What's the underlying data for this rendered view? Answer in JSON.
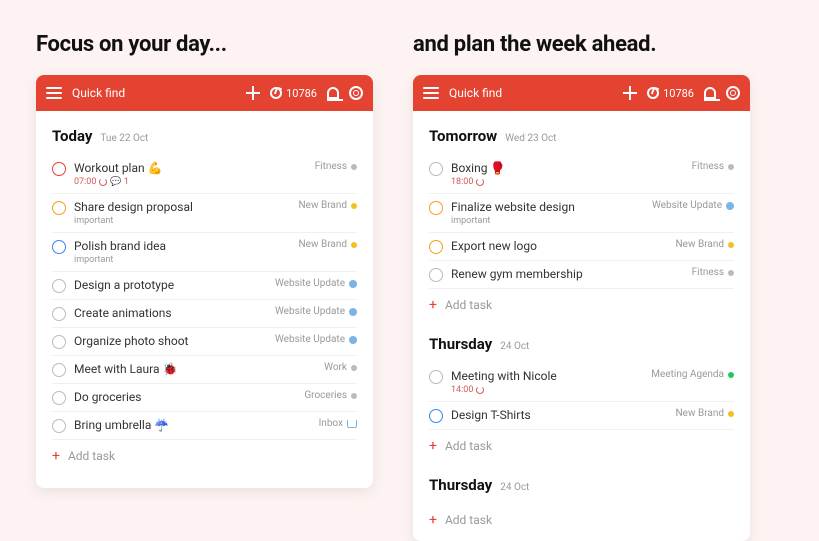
{
  "headings": {
    "left": "Focus on your day...",
    "right": "and plan the week ahead."
  },
  "topbar": {
    "quickfind": "Quick find",
    "karma_count": "10786"
  },
  "add_task_label": "Add task",
  "left": {
    "section": {
      "title": "Today",
      "sub": "Tue 22 Oct"
    },
    "tasks": [
      {
        "name": "Workout plan 💪",
        "circle": "red",
        "meta": {
          "text": "07:00",
          "recur": true,
          "comments": "1",
          "color": "red"
        },
        "project": "Fitness",
        "tag": "dot-gray"
      },
      {
        "name": "Share design proposal",
        "circle": "orange",
        "meta": {
          "text": "important",
          "color": "gray"
        },
        "project": "New Brand",
        "tag": "dot-yellow"
      },
      {
        "name": "Polish brand idea",
        "circle": "blue",
        "meta": {
          "text": "important",
          "color": "gray"
        },
        "project": "New Brand",
        "tag": "dot-yellow"
      },
      {
        "name": "Design a prototype",
        "circle": "gray",
        "project": "Website Update",
        "tag": "person"
      },
      {
        "name": "Create animations",
        "circle": "gray",
        "project": "Website Update",
        "tag": "person"
      },
      {
        "name": "Organize photo shoot",
        "circle": "gray",
        "project": "Website Update",
        "tag": "person"
      },
      {
        "name": "Meet with Laura 🐞",
        "circle": "gray",
        "project": "Work",
        "tag": "dot-gray"
      },
      {
        "name": "Do groceries",
        "circle": "gray",
        "project": "Groceries",
        "tag": "dot-gray"
      },
      {
        "name": "Bring umbrella ☔",
        "circle": "gray",
        "project": "Inbox",
        "tag": "inbox"
      }
    ]
  },
  "right": {
    "sections": [
      {
        "title": "Tomorrow",
        "sub": "Wed 23 Oct",
        "tasks": [
          {
            "name": "Boxing 🥊",
            "circle": "gray",
            "meta": {
              "text": "18:00",
              "recur": true,
              "color": "red"
            },
            "project": "Fitness",
            "tag": "dot-gray"
          },
          {
            "name": "Finalize website design",
            "circle": "orange",
            "meta": {
              "text": "important",
              "color": "gray"
            },
            "project": "Website Update",
            "tag": "person"
          },
          {
            "name": "Export new logo",
            "circle": "orange",
            "project": "New Brand",
            "tag": "dot-yellow"
          },
          {
            "name": "Renew gym membership",
            "circle": "gray",
            "project": "Fitness",
            "tag": "dot-gray"
          }
        ]
      },
      {
        "title": "Thursday",
        "sub": "24 Oct",
        "tasks": [
          {
            "name": "Meeting with Nicole",
            "circle": "gray",
            "meta": {
              "text": "14:00",
              "recur": true,
              "color": "red"
            },
            "project": "Meeting Agenda",
            "tag": "dot-green"
          },
          {
            "name": "Design T-Shirts",
            "circle": "blue",
            "project": "New Brand",
            "tag": "dot-yellow"
          }
        ]
      },
      {
        "title": "Thursday",
        "sub": "24 Oct",
        "tasks": []
      }
    ]
  }
}
